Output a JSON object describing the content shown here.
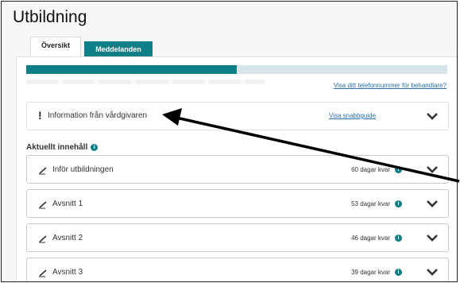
{
  "page": {
    "title": "Utbildning"
  },
  "tabs": [
    {
      "label": "Översikt",
      "active": true
    },
    {
      "label": "Meddelanden",
      "active": false
    }
  ],
  "progress": {
    "fraction": 0.5
  },
  "links": {
    "phone": "Visa ditt telefonnummer för behandlare?"
  },
  "info_card": {
    "icon": "exclamation-icon",
    "label": "Information från vårdgivaren",
    "link": "Visa snabbguide"
  },
  "section": {
    "heading": "Aktuellt innehåll"
  },
  "items": [
    {
      "label": "Inför utbildningen",
      "days": "60 dagar kvar"
    },
    {
      "label": "Avsnitt 1",
      "days": "53 dagar kvar"
    },
    {
      "label": "Avsnitt 2",
      "days": "46 dagar kvar"
    },
    {
      "label": "Avsnitt 3",
      "days": "39 dagar kvar"
    }
  ],
  "colors": {
    "accent": "#0e7f86",
    "link": "#2a6fb0"
  }
}
